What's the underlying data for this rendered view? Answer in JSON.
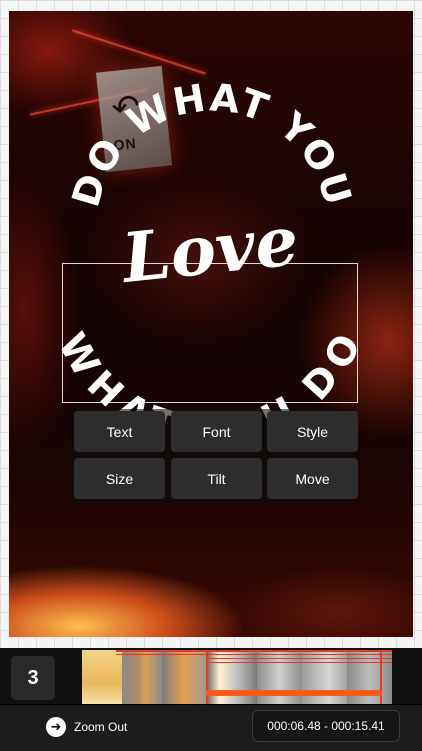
{
  "quote": {
    "top_arc": "DO WHAT YOU",
    "center": "Love",
    "bottom_arc": "WHAT YOU DO"
  },
  "background": {
    "sign_text": "ON"
  },
  "menu": {
    "text": "Text",
    "font": "Font",
    "style": "Style",
    "size": "Size",
    "tilt": "Tilt",
    "move": "Move"
  },
  "timeline": {
    "step_number": "3"
  },
  "toolbar": {
    "zoom_out_label": "Zoom Out",
    "zoom_out_icon": "arrow-right-circle-icon",
    "time_range": "000:06.48 - 000:15.41"
  },
  "colors": {
    "accent": "#e43a1f",
    "menu_button": "#2d2d2d",
    "bottom_bar": "#111111"
  }
}
